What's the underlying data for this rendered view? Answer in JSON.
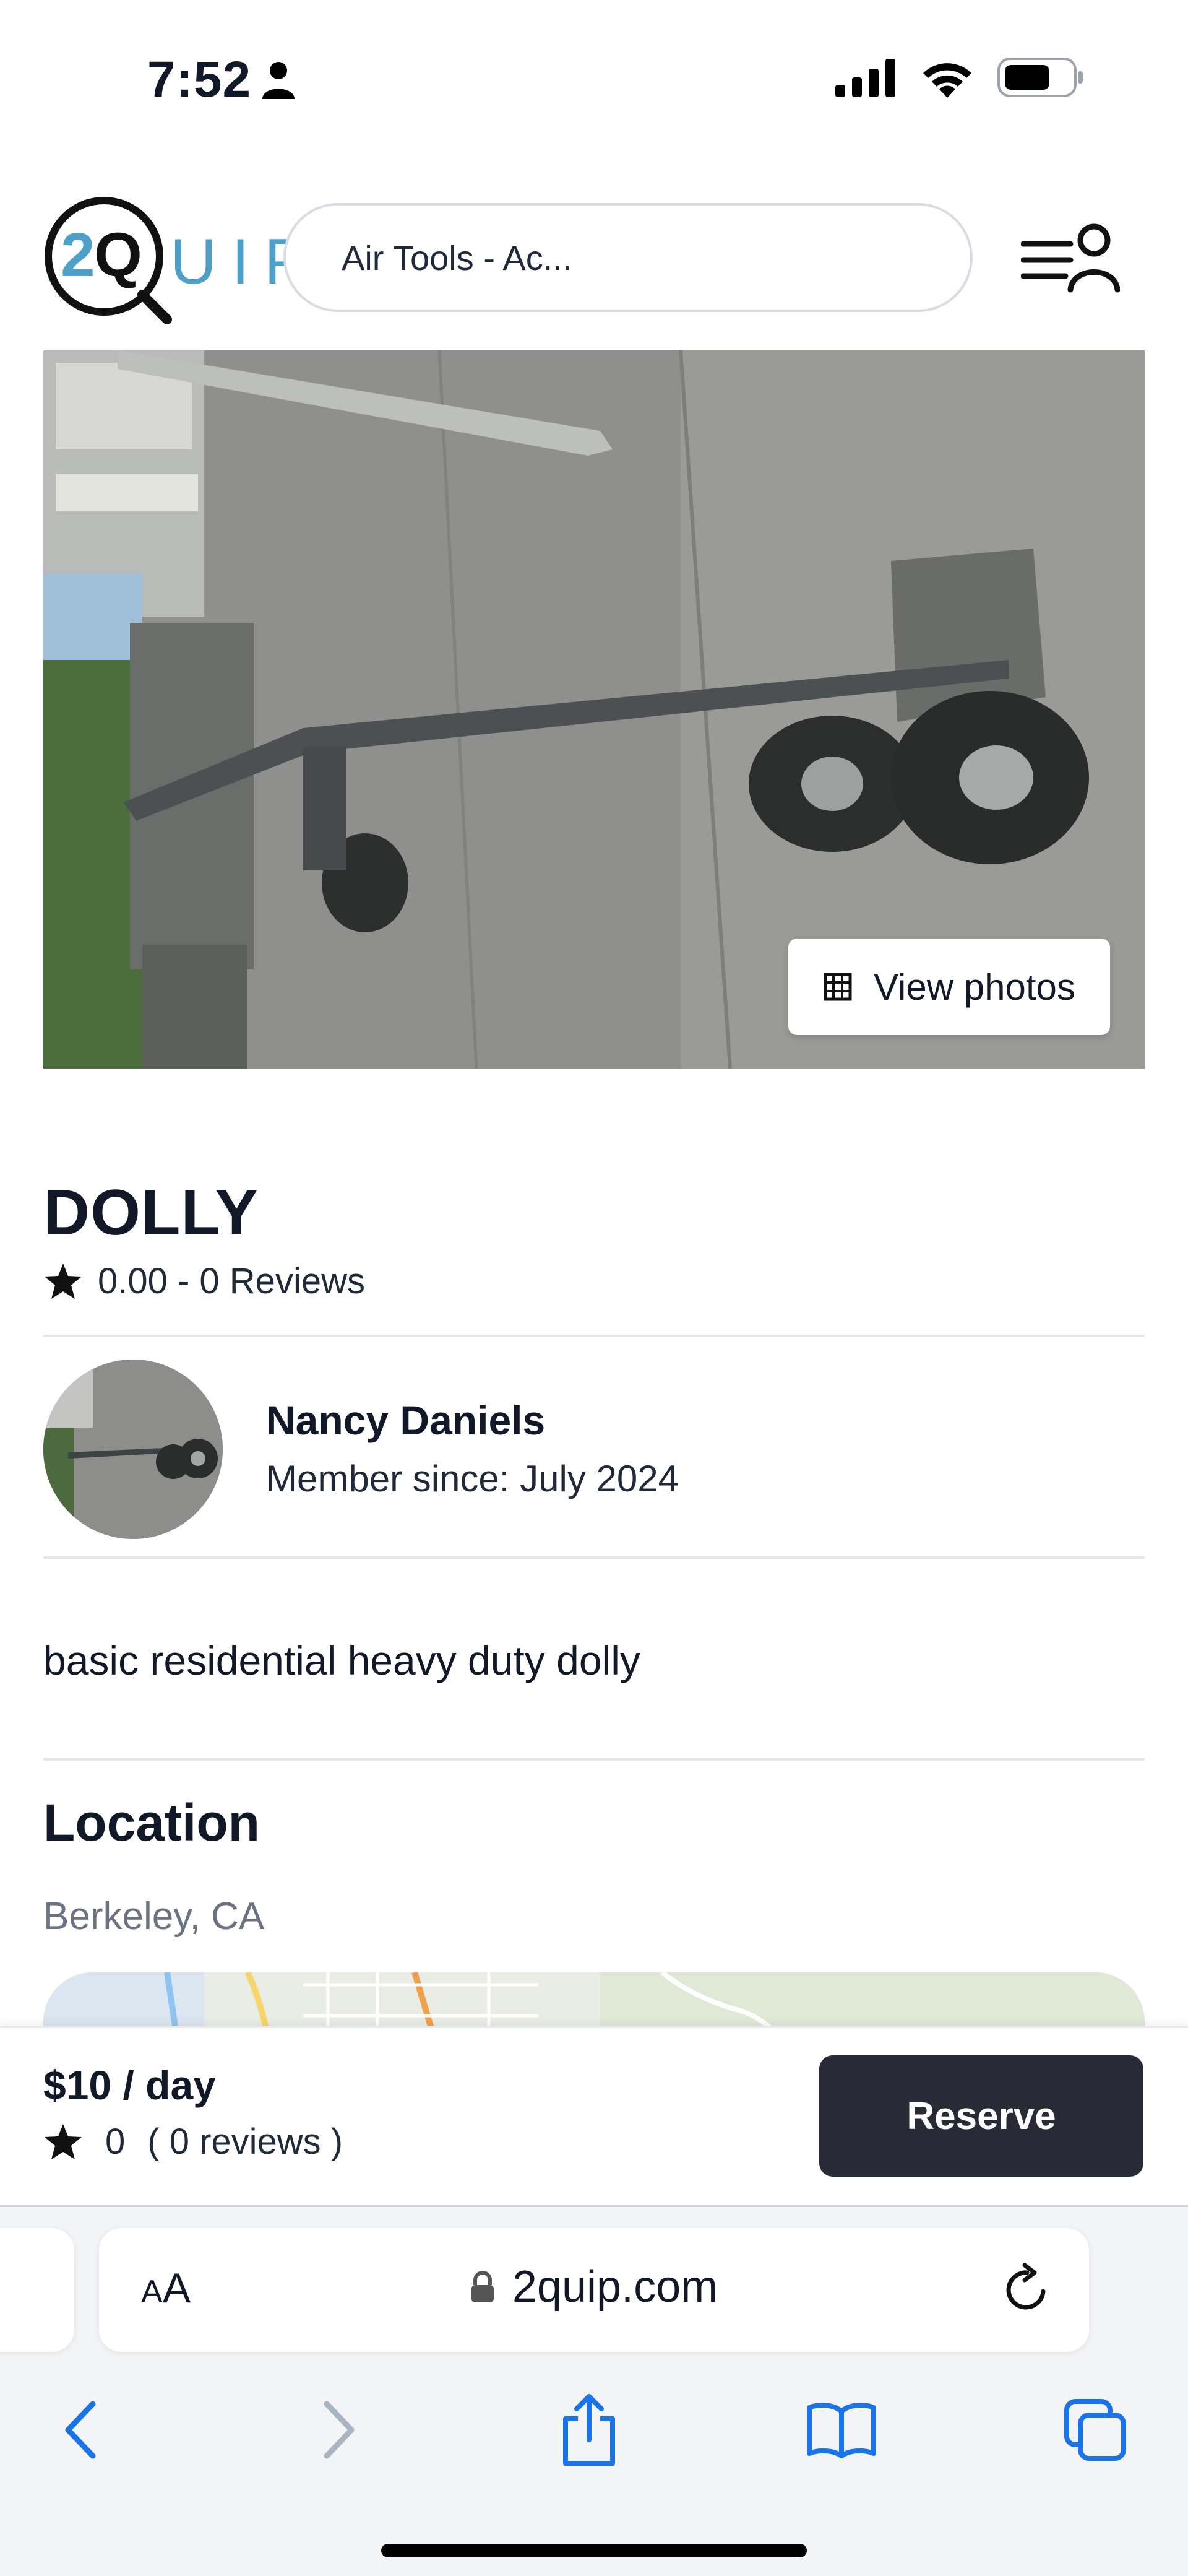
{
  "status_bar": {
    "time": "7:52",
    "icons": [
      "person-icon",
      "cellular-signal-icon",
      "wifi-icon",
      "battery-icon"
    ]
  },
  "header": {
    "logo_mark": "2Q",
    "logo_word": "UIP",
    "search_value": "Air Tools - Ac...",
    "menu_icon": "menu-user-icon"
  },
  "hero": {
    "view_photos_label": "View photos",
    "view_photos_icon": "grid-icon"
  },
  "listing": {
    "title": "DOLLY",
    "rating_text": "0.00 - 0 Reviews",
    "description": "basic residential heavy duty dolly"
  },
  "owner": {
    "name": "Nancy Daniels",
    "member_since": "Member since: July 2024"
  },
  "location": {
    "heading": "Location",
    "city": "Berkeley, CA"
  },
  "reserve_bar": {
    "price": "$10 / day",
    "rating": "0",
    "reviews": "( 0 reviews )",
    "reserve_label": "Reserve"
  },
  "browser": {
    "aa_label_small": "A",
    "aa_label_large": "A",
    "url": "2quip.com",
    "toolbar_icons": [
      "back-icon",
      "forward-icon",
      "share-icon",
      "bookmarks-icon",
      "tabs-icon"
    ]
  },
  "colors": {
    "accent_logo": "#4ea0c9",
    "button_dark": "#282b36",
    "ios_blue": "#1a73e8"
  }
}
